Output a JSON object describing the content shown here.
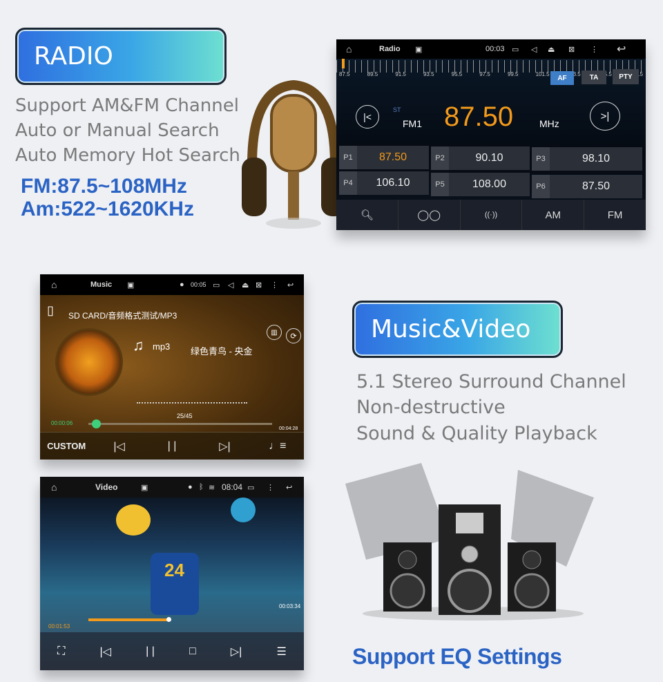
{
  "radio_section": {
    "title": "RADIO",
    "features": [
      "Support AM&FM Channel",
      "Auto or Manual Search",
      "Auto Memory Hot Search"
    ],
    "ranges": [
      "FM:87.5~108MHz",
      "Am:522~1620KHz"
    ]
  },
  "radio_ui": {
    "app_title": "Radio",
    "time": "00:03",
    "scale": [
      "87.5",
      "89.5",
      "91.5",
      "93.5",
      "95.5",
      "97.5",
      "99.5",
      "101.5",
      "103.5",
      "105.5",
      "107.5"
    ],
    "buttons": {
      "af": "AF",
      "ta": "TA",
      "pty": "PTY"
    },
    "stereo": "ST",
    "band": "FM1",
    "frequency": "87.50",
    "unit": "MHz",
    "presets": [
      {
        "label": "P1",
        "value": "87.50"
      },
      {
        "label": "P2",
        "value": "90.10"
      },
      {
        "label": "P3",
        "value": "98.10"
      },
      {
        "label": "P4",
        "value": "106.10"
      },
      {
        "label": "P5",
        "value": "108.00"
      },
      {
        "label": "P6",
        "value": "87.50"
      }
    ],
    "bottom": {
      "am": "AM",
      "fm": "FM"
    },
    "accent": "#f29a1b"
  },
  "music_ui": {
    "app_title": "Music",
    "time": "00:05",
    "path": "SD CARD/音频格式测试/MP3",
    "format": "mp3",
    "song": "绿色青鸟 - 央金",
    "track": "25/45",
    "elapsed": "00:00:06",
    "total": "00:04:28",
    "progress": 0.02,
    "eq_label": "CUSTOM"
  },
  "music_section": {
    "title": "Music&Video",
    "features": [
      "5.1 Stereo Surround Channel",
      "Non-destructive",
      "Sound & Quality Playback"
    ],
    "eq": "Support EQ Settings"
  },
  "video_ui": {
    "app_title": "Video",
    "time": "08:04",
    "elapsed": "00:01:53",
    "total": "00:03:34",
    "progress": 0.45,
    "player_number": "24"
  }
}
